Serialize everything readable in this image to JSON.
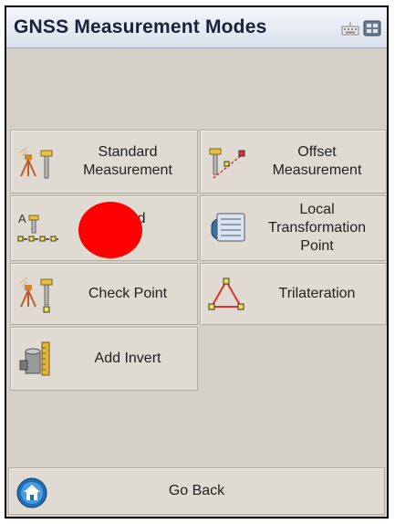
{
  "window": {
    "title": "GNSS Measurement Modes",
    "icons": [
      "keyboard-icon",
      "window-switch-icon"
    ]
  },
  "modes": [
    {
      "label": "Standard\nMeasurement",
      "icon": "tripod-rover-icon"
    },
    {
      "label": "Offset\nMeasurement",
      "icon": "offset-icon"
    },
    {
      "label": "Record\nPoints",
      "icon": "points-line-icon",
      "partially_obscured": true
    },
    {
      "label": "Local\nTransformation\nPoint",
      "icon": "transformation-icon"
    },
    {
      "label": "Check Point",
      "icon": "check-point-icon"
    },
    {
      "label": "Trilateration",
      "icon": "triangle-icon"
    },
    {
      "label": "Add Invert",
      "icon": "pipe-icon"
    }
  ],
  "footer": {
    "go_back_label": "Go Back",
    "icon": "home-icon"
  }
}
